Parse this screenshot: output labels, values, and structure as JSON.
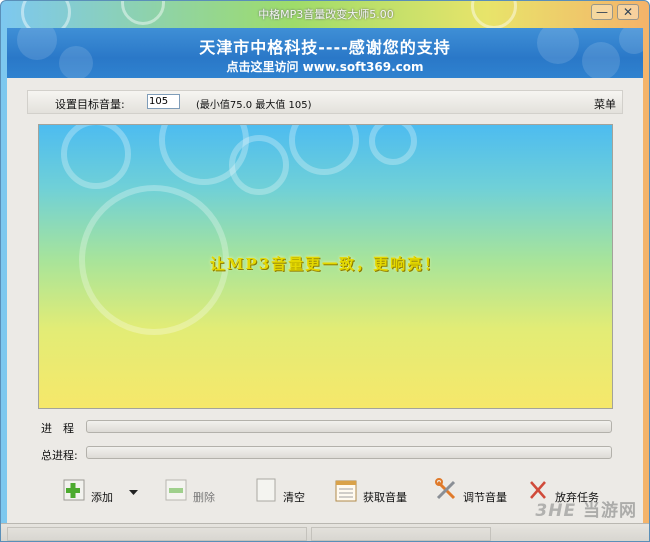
{
  "window": {
    "title": "中格MP3音量改变大师5.00",
    "controls": {
      "minimize": "—",
      "close": "✕"
    }
  },
  "banner": {
    "title": "天津市中格科技----感谢您的支持",
    "subtitle": "点击这里访问 www.soft369.com"
  },
  "settings": {
    "target_label": "设置目标音量:",
    "target_value": "105",
    "range_text": "(最小值75.0   最大值 105)",
    "menu_label": "菜单"
  },
  "canvas": {
    "slogan": "让MP3音量更一致，更响亮！"
  },
  "progress": {
    "current_label": "进　程",
    "current_value": 0,
    "total_label": "总进程:",
    "total_value": 0
  },
  "toolbar": {
    "add": {
      "label": "添加",
      "icon": "plus-icon"
    },
    "delete": {
      "label": "删除",
      "icon": "minus-icon"
    },
    "clear": {
      "label": "清空",
      "icon": "blank-page-icon"
    },
    "get_volume": {
      "label": "获取音量",
      "icon": "calendar-list-icon"
    },
    "adjust_volume": {
      "label": "调节音量",
      "icon": "wrench-screwdriver-icon"
    },
    "abort": {
      "label": "放弃任务",
      "icon": "abort-icon"
    }
  },
  "watermark": {
    "brand_a": "3HE",
    "brand_b": "当游网"
  },
  "colors": {
    "banner_blue": "#2a78c8",
    "add_green": "#4caa2e",
    "slogan_yellow": "#e4d800"
  }
}
